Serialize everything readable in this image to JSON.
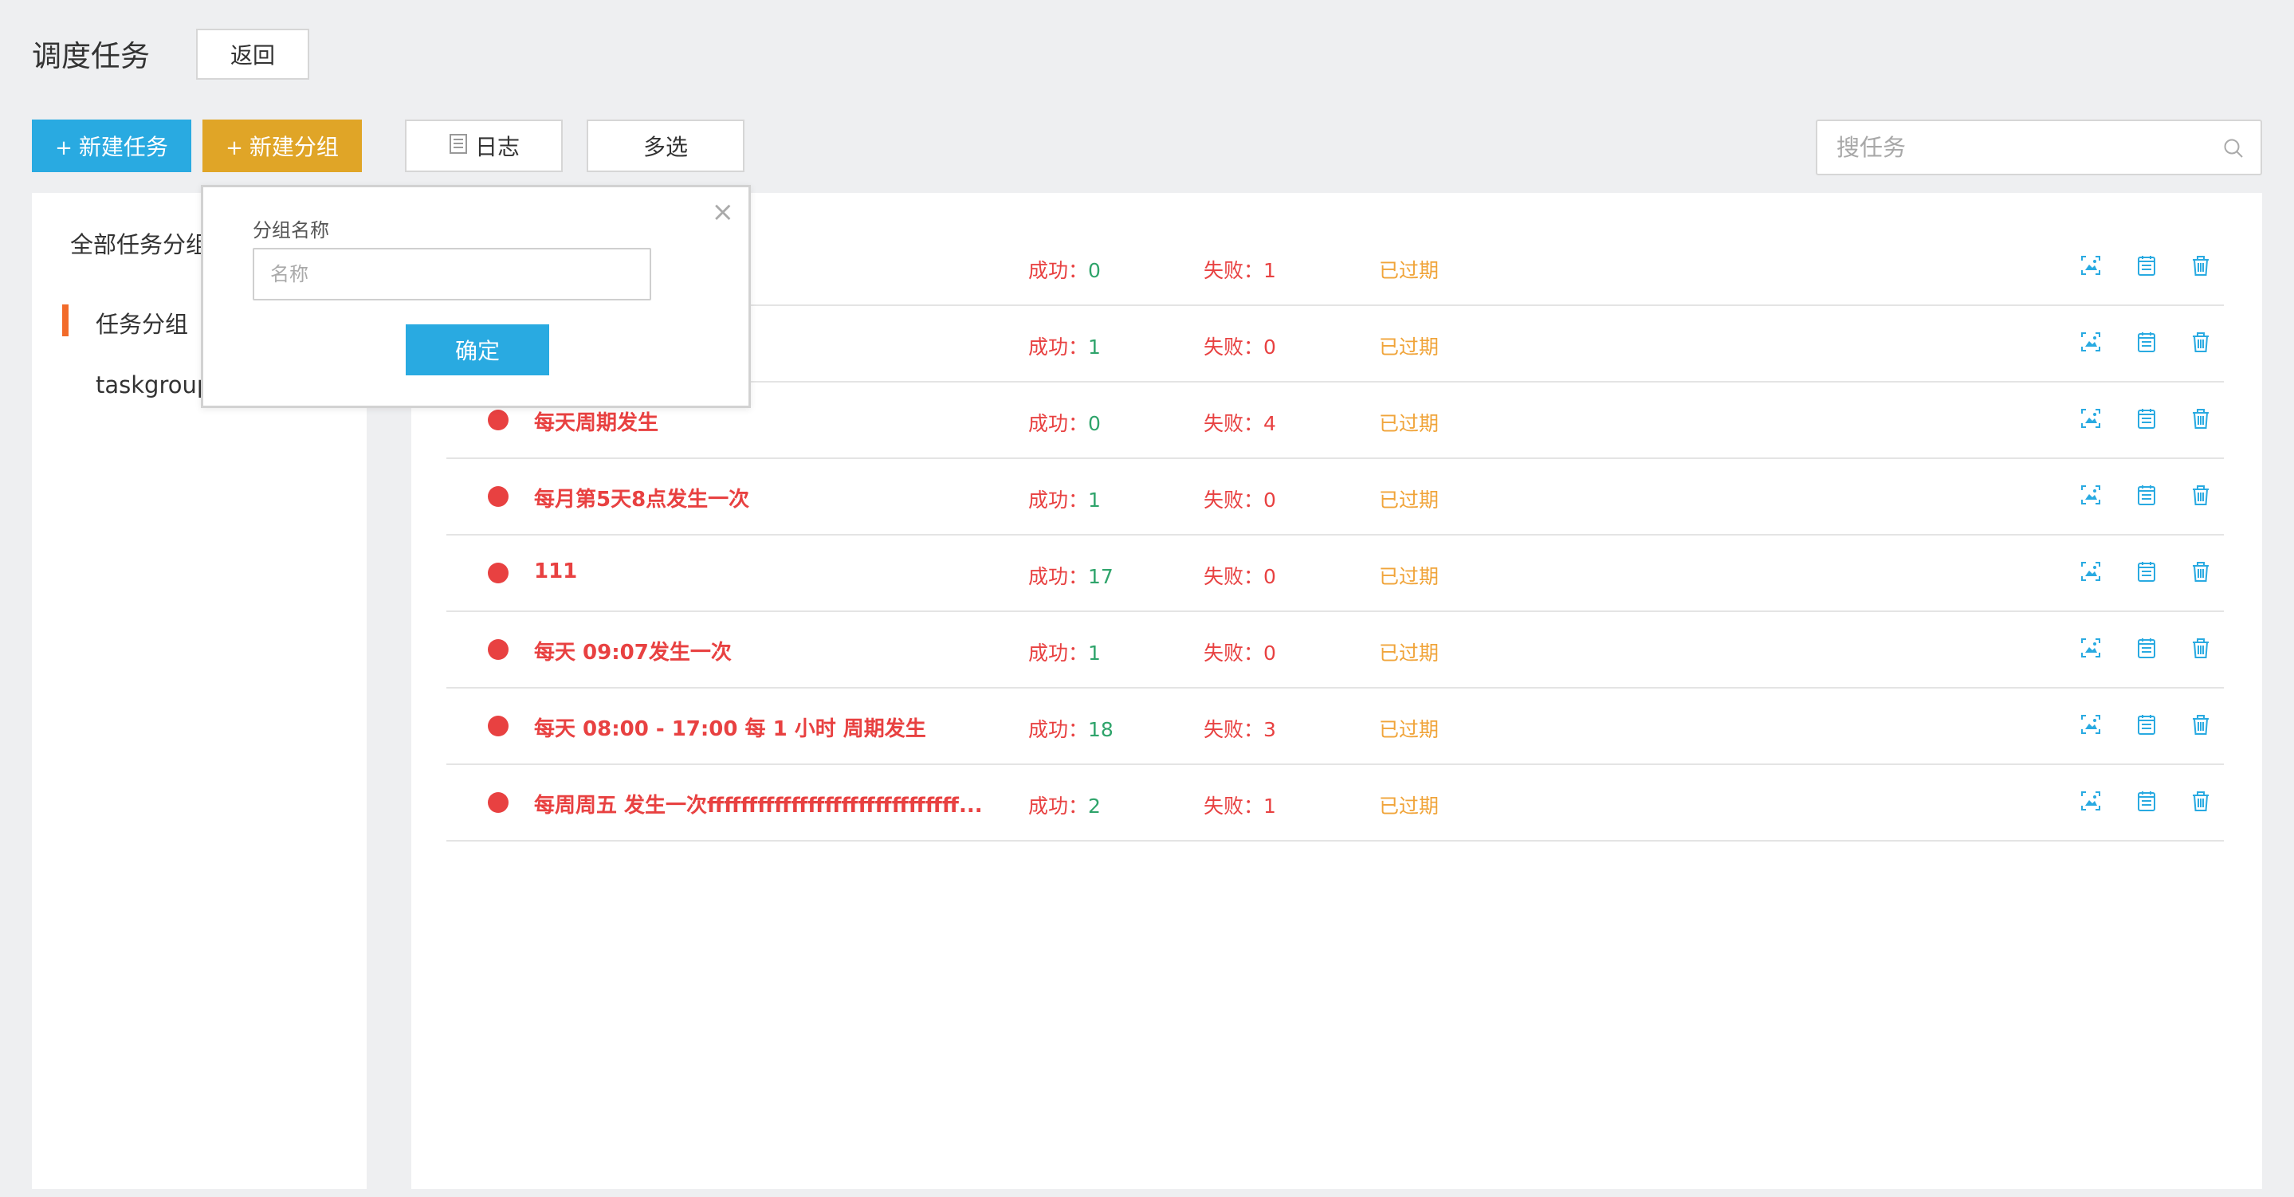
{
  "header": {
    "title": "调度任务",
    "back_label": "返回"
  },
  "toolbar": {
    "plus": "+",
    "new_task_label": "新建任务",
    "new_group_label": "新建分组",
    "log_label": "日志",
    "multi_label": "多选",
    "search_placeholder": "搜任务"
  },
  "sidebar": {
    "title": "全部任务分组",
    "groups": [
      {
        "label": "任务分组",
        "active": true
      },
      {
        "label": "taskgroup",
        "active": false
      }
    ]
  },
  "popover": {
    "field_label": "分组名称",
    "input_placeholder": "名称",
    "confirm_label": "确定",
    "close_symbol": "×"
  },
  "labels": {
    "success": "成功：",
    "fail": "失败："
  },
  "tasks": [
    {
      "name": "",
      "success": "0",
      "fail": "1",
      "status": "已过期"
    },
    {
      "name": "",
      "success": "1",
      "fail": "0",
      "status": "已过期"
    },
    {
      "name": "每天周期发生",
      "success": "0",
      "fail": "4",
      "status": "已过期"
    },
    {
      "name": "每月第5天8点发生一次",
      "success": "1",
      "fail": "0",
      "status": "已过期"
    },
    {
      "name": "111",
      "success": "17",
      "fail": "0",
      "status": "已过期"
    },
    {
      "name": "每天 09:07发生一次",
      "success": "1",
      "fail": "0",
      "status": "已过期"
    },
    {
      "name": "每天 08:00 - 17:00 每 1 小时 周期发生",
      "success": "18",
      "fail": "3",
      "status": "已过期"
    },
    {
      "name": "每周周五 发生一次ffffffffffffffffffffffffffffff...",
      "success": "2",
      "fail": "1",
      "status": "已过期"
    }
  ],
  "colors": {
    "primary": "#29aae1",
    "warning": "#e0a527",
    "danger": "#e84141",
    "success": "#2fa46b",
    "expired": "#f0a43a",
    "accent_bar": "#f26b2a"
  }
}
